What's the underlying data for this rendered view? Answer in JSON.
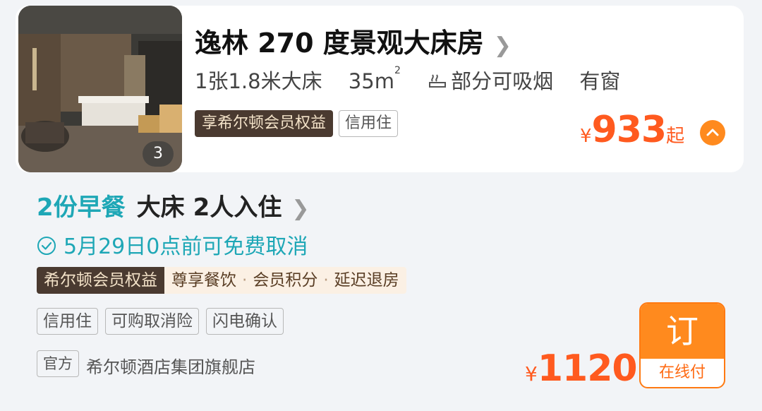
{
  "room": {
    "photo_count": "3",
    "title": "逸林 270 度景观大床房",
    "specs": {
      "bed": "1张1.8米大床",
      "area": "35m",
      "area_sup": "2",
      "smoking": "部分可吸烟",
      "window": "有窗"
    },
    "tags": [
      "享希尔顿会员权益",
      "信用住"
    ],
    "price": {
      "currency": "¥",
      "amount": "933",
      "suffix": "起"
    }
  },
  "plan": {
    "breakfast": "2份早餐",
    "bed": "大床",
    "guests": "2人入住",
    "cancel_policy": "5月29日0点前可免费取消",
    "benefit_head": "希尔顿会员权益",
    "benefits": [
      "尊享餐饮",
      "会员积分",
      "延迟退房"
    ],
    "tags": [
      "信用住",
      "可购取消险",
      "闪电确认"
    ],
    "official_tag": "官方",
    "store_name": "希尔顿酒店集团旗舰店",
    "price": {
      "currency": "¥",
      "amount": "1120"
    },
    "book_label": "订",
    "pay_label": "在线付"
  },
  "colors": {
    "accent": "#ff5a1f",
    "teal": "#1ea7b6",
    "member_dark": "#4a3a30"
  },
  "icons": [
    "chevron-right-icon",
    "smoking-icon",
    "chevron-up-icon",
    "check-circle-icon"
  ]
}
